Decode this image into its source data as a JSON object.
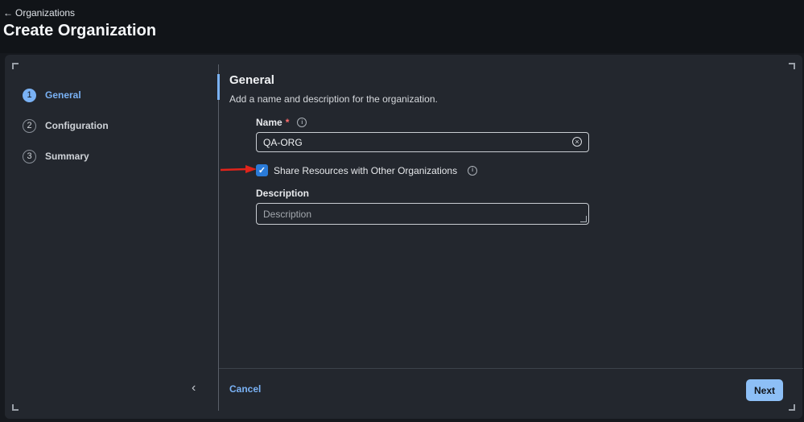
{
  "header": {
    "back_arrow": "←",
    "back_label": "Organizations",
    "title": "Create Organization"
  },
  "steps": [
    {
      "number": "1",
      "label": "General",
      "active": true
    },
    {
      "number": "2",
      "label": "Configuration",
      "active": false
    },
    {
      "number": "3",
      "label": "Summary",
      "active": false
    }
  ],
  "sidebar": {
    "collapse_icon": "‹"
  },
  "form": {
    "section_title": "General",
    "section_desc": "Add a name and description for the organization.",
    "name_label": "Name",
    "required_mark": "*",
    "info_glyph": "i",
    "name_value": "QA-ORG",
    "clear_glyph": "×",
    "share_checked": true,
    "check_glyph": "✓",
    "share_label": "Share Resources with Other Organizations",
    "description_label": "Description",
    "description_placeholder": "Description"
  },
  "footer": {
    "cancel_label": "Cancel",
    "next_label": "Next"
  },
  "colors": {
    "accent": "#7ab2f5",
    "checkbox": "#2a7bd8",
    "annotation_arrow": "#e0241b"
  }
}
